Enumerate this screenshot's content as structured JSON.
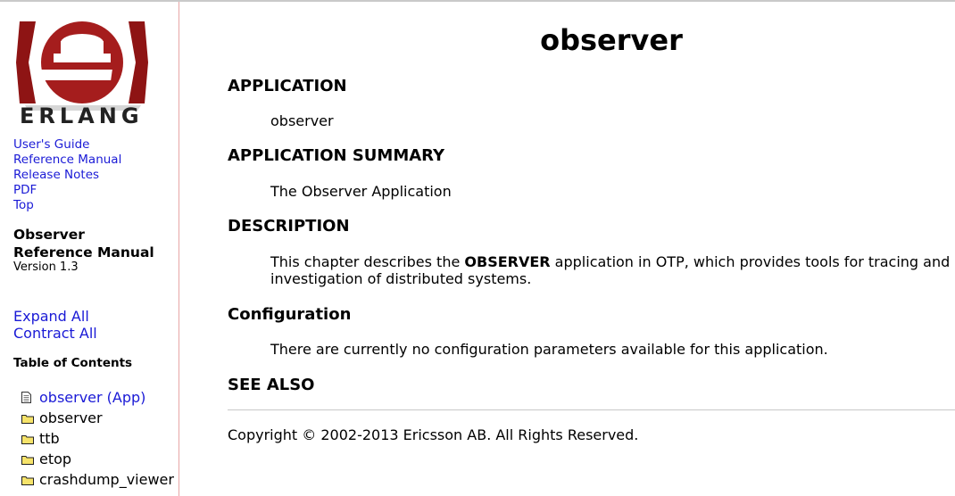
{
  "sidebar": {
    "logo_word": "ERLANG",
    "links": [
      "User's Guide",
      "Reference Manual",
      "Release Notes",
      "PDF",
      "Top"
    ],
    "manual_title_line1": "Observer",
    "manual_title_line2": "Reference Manual",
    "version": "Version 1.3",
    "expand_all": "Expand All",
    "contract_all": "Contract All",
    "toc_heading": "Table of Contents",
    "toc": [
      {
        "label": "observer (App)",
        "icon": "document-icon",
        "link": true
      },
      {
        "label": "observer",
        "icon": "folder-icon",
        "link": false
      },
      {
        "label": "ttb",
        "icon": "folder-icon",
        "link": false
      },
      {
        "label": "etop",
        "icon": "folder-icon",
        "link": false
      },
      {
        "label": "crashdump_viewer",
        "icon": "folder-icon",
        "link": false
      }
    ]
  },
  "main": {
    "title": "observer",
    "sections": {
      "application_heading": "APPLICATION",
      "application_text": "observer",
      "summary_heading": "APPLICATION SUMMARY",
      "summary_text": "The Observer Application",
      "description_heading": "DESCRIPTION",
      "description_pre": "This chapter describes the ",
      "description_bold": "OBSERVER",
      "description_post": " application in OTP, which provides tools for tracing and investigation of distributed systems.",
      "configuration_heading": "Configuration",
      "configuration_text": "There are currently no configuration parameters available for this application.",
      "see_also_heading": "SEE ALSO"
    },
    "copyright": "Copyright © 2002-2013 Ericsson AB. All Rights Reserved."
  },
  "colors": {
    "link": "#1a1ad6",
    "logo_red": "#a51d1d",
    "sidebar_border": "#e7a6a6"
  }
}
